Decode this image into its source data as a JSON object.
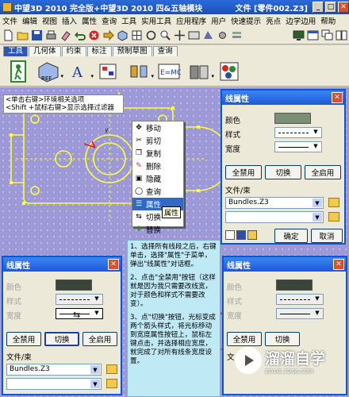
{
  "titlebar": {
    "title": "中望3D 2010 完全版+中望3D 2010 四&五轴模块",
    "right": "文件 [零件002.Z3]"
  },
  "menubar": {
    "items": [
      "文件",
      "编辑",
      "视图",
      "插入",
      "属性",
      "查询",
      "工具",
      "实用工具",
      "应用程序",
      "用户",
      "快速提示",
      "亮点",
      "边学边用",
      "帮助"
    ]
  },
  "tabs": [
    "工具",
    "几何体",
    "约束",
    "标注",
    "预制草图",
    "查询"
  ],
  "ribbon": {
    "icons": [
      "exit-icon",
      "reference-icon",
      "text-icon",
      "pattern-icon",
      "mirror-icon",
      "equation-icon",
      "insert-icon",
      "color-icon"
    ]
  },
  "hint": {
    "line1": "<单击右键>环境相关选项",
    "line2": "<Shift +鼠标右键>显示选择过滤器"
  },
  "context_menu": {
    "items": [
      "移动",
      "剪切",
      "复制",
      "删除",
      "隐藏",
      "查询",
      "属性",
      "切换",
      "替换"
    ],
    "highlighted": "属性",
    "tooltip": "属性"
  },
  "dialog_top": {
    "title": "线属性",
    "color_label": "颜色",
    "style_label": "样式",
    "width_label": "宽度",
    "disable_all": "全禁用",
    "toggle": "切换",
    "enable_all": "全启用",
    "file_label": "文件/束",
    "file_value": "Bundles.Z3",
    "ok": "确定",
    "cancel": "取消"
  },
  "dialog_left": {
    "title": "线属性",
    "color_label": "颜色",
    "style_label": "样式",
    "width_label": "宽度",
    "disable_all": "全禁用",
    "toggle": "切换",
    "enable_all": "全启用",
    "file_label": "文件/束",
    "file_value": "Bundles.Z3"
  },
  "dialog_right": {
    "title": "线属性",
    "color_label": "颜色",
    "style_label": "样式",
    "width_label": "宽度",
    "disable_all": "全禁用",
    "toggle": "切换",
    "file_label": "文"
  },
  "note": {
    "p1": "1、选择所有线段之后，右键单击，选择\"属性\"子菜单，弹出\"线属性\"对话框。",
    "p2": "2、点击\"全禁用\"按钮（这样就是因为我只需要改线宽，对于颜色和样式不需要改变）。",
    "p3": "3、点\"切换\"按钮，光标变成两个箭头样式，将光标移动到宽度属性按钮上，鼠标左键点击，并选择相应宽度，就完成了对所有线条宽度设置。"
  },
  "watermark": {
    "brand": "溜溜自学",
    "url": "ZIXUE.3D66.COM"
  },
  "colors": {
    "dialog_border": "#0a56d4",
    "canvas": "#9d98d6",
    "highlight": "#316ac5",
    "note_bg": "#bfe9f5",
    "swatch_green": "#7a8f74"
  }
}
